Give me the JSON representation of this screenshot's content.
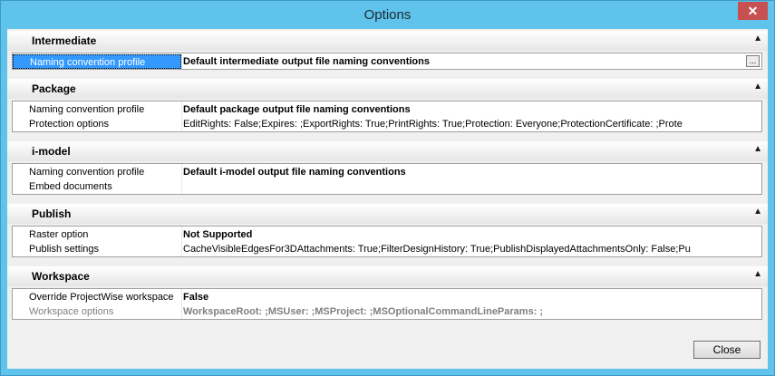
{
  "window": {
    "title": "Options",
    "close_glyph": "✕"
  },
  "sections": [
    {
      "title": "Intermediate",
      "rows": [
        {
          "label": "Naming convention profile",
          "value": "Default intermediate output file naming conventions",
          "button": "..."
        }
      ]
    },
    {
      "title": "Package",
      "rows": [
        {
          "label": "Naming convention profile",
          "value": "Default package output file naming conventions"
        },
        {
          "label": "Protection options",
          "value": "EditRights: False;Expires: ;ExportRights: True;PrintRights: True;Protection: Everyone;ProtectionCertificate: ;Prote"
        }
      ]
    },
    {
      "title": "i-model",
      "rows": [
        {
          "label": "Naming convention profile",
          "value": "Default i-model output file naming conventions"
        },
        {
          "label": "Embed documents",
          "value": ""
        }
      ]
    },
    {
      "title": "Publish",
      "rows": [
        {
          "label": "Raster option",
          "value": "Not Supported"
        },
        {
          "label": "Publish settings",
          "value": "CacheVisibleEdgesFor3DAttachments: True;FilterDesignHistory: True;PublishDisplayedAttachmentsOnly: False;Pu"
        }
      ]
    },
    {
      "title": "Workspace",
      "rows": [
        {
          "label": "Override ProjectWise workspace",
          "value": "False"
        },
        {
          "label": "Workspace options",
          "value": "WorkspaceRoot: ;MSUser: ;MSProject: ;MSOptionalCommandLineParams: ;"
        }
      ]
    }
  ],
  "buttons": {
    "close": "Close"
  },
  "icons": {
    "collapse": "chevron-up-icon"
  },
  "colors": {
    "titlebar": "#5fc3ec",
    "close": "#c75050",
    "selection": "#3399ff"
  }
}
